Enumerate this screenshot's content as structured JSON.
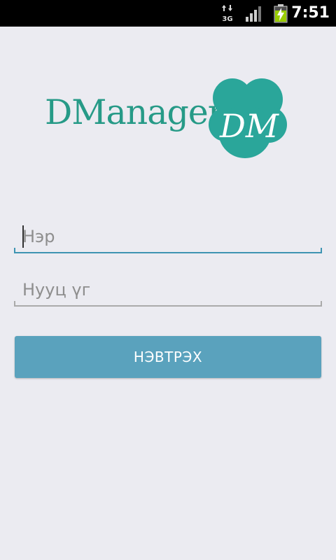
{
  "status_bar": {
    "network": "3G",
    "time": "7:51",
    "icons": [
      "data-arrows-icon",
      "signal-icon",
      "battery-charging-icon"
    ]
  },
  "logo": {
    "text": "DManager",
    "monogram": "DM"
  },
  "form": {
    "name_placeholder": "Нэр",
    "password_placeholder": "Нууц үг",
    "login_label": "НЭВТРЭХ"
  },
  "colors": {
    "background": "#ebebf1",
    "brand_teal": "#269a87",
    "accent_blue": "#3d94b2",
    "button": "#5aa2bd"
  }
}
